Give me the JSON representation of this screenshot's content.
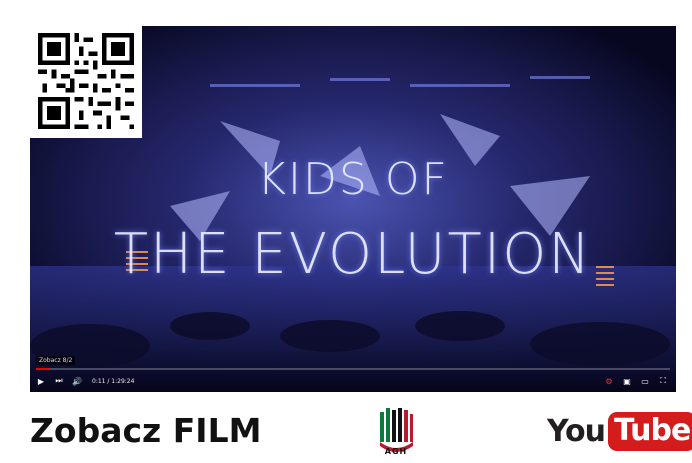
{
  "video": {
    "title_line1": "KIDS OF",
    "title_line2": "THE EVOLUTION",
    "channel_label": "Zobacz 8/2",
    "time": "0:11 / 1:29:24",
    "progress": 0.02,
    "colors": {
      "background": "#0a0a2a",
      "stage_glow": "#3b3f9e",
      "accent": "#e00000"
    },
    "controls": {
      "play_icon": "play-icon",
      "next_icon": "next-icon",
      "volume_icon": "volume-icon",
      "settings_icon": "settings-icon",
      "miniplayer_icon": "miniplayer-icon",
      "theater_icon": "theater-icon",
      "fullscreen_icon": "fullscreen-icon"
    }
  },
  "footer": {
    "headline": "Zobacz FILM",
    "agh_label": "AGH",
    "youtube_you": "You",
    "youtube_tube": "Tube",
    "colors": {
      "agh_green": "#0b7a3b",
      "agh_red": "#b71c2e",
      "youtube_red": "#d41c1c"
    }
  }
}
